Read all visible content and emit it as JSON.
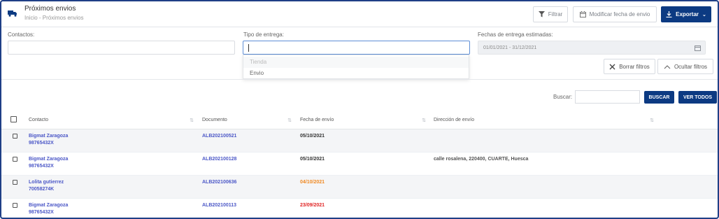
{
  "header": {
    "title": "Próximos envios",
    "breadcrumb": "Inicio - Próximos envios",
    "buttons": {
      "filter": "Filtrar",
      "modify_date": "Modificar fecha de envio",
      "export": "Exportar"
    }
  },
  "filters": {
    "contacts_label": "Contactos:",
    "contacts_value": "",
    "delivery_type_label": "Tipo de entrega:",
    "delivery_type_value": "",
    "delivery_type_options": [
      "Tienda",
      "Envio"
    ],
    "dates_label": "Fechas de entrega estimadas:",
    "dates_value": "01/01/2021 - 31/12/2021",
    "clear_label": "Borrar filtros",
    "hide_label": "Ocultar filtros"
  },
  "search": {
    "label": "Buscar:",
    "value": "",
    "search_button": "BUSCAR",
    "view_all_button": "VER TODOS"
  },
  "table": {
    "columns": [
      "Contacto",
      "Documento",
      "Fecha de envío",
      "Dirección de envío"
    ],
    "rows": [
      {
        "contact": "Bigmat Zaragoza",
        "contact_id": "98765432X",
        "document": "ALB202100521",
        "date": "05/10/2021",
        "address": ""
      },
      {
        "contact": "Bigmat Zaragoza",
        "contact_id": "98765432X",
        "document": "ALB202100128",
        "date": "05/10/2021",
        "address": "calle rosalena, 220400, CUARTE, Huesca"
      },
      {
        "contact": "Lolita gutierrez",
        "contact_id": "70058274K",
        "document": "ALB202100636",
        "date": "04/10/2021",
        "address": ""
      },
      {
        "contact": "Bigmat Zaragoza",
        "contact_id": "98765432X",
        "document": "ALB202100113",
        "date": "23/09/2021",
        "address": ""
      }
    ]
  },
  "colors": {
    "primary": "#0c3a82",
    "link": "#4b57c7",
    "date_normal": "#333333",
    "date_soon": "#f08a24",
    "date_overdue": "#e02424"
  },
  "icons": {
    "header": "truck-icon",
    "filter": "funnel-icon",
    "modify": "calendar-icon",
    "export": "download-icon",
    "clear": "x-icon",
    "hide": "chevron-up-icon",
    "sort": "sort-icon"
  }
}
